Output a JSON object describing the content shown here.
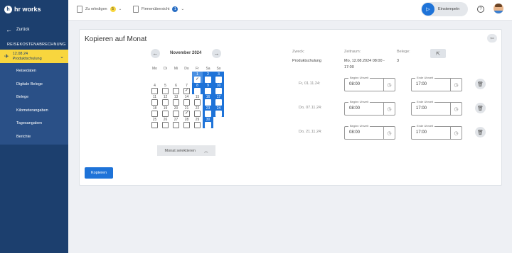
{
  "app": {
    "logo": "hr works"
  },
  "sidebar": {
    "back_label": "Zurück",
    "section_title": "REISEKOSTENABRECHNUNG",
    "trip": {
      "date": "12.08.24",
      "name": "Produktschulung"
    },
    "items": [
      "Reisedaten",
      "Digitale Belege",
      "Belege",
      "Kilometerangaben",
      "Tagesangaben",
      "Berichte"
    ]
  },
  "topbar": {
    "todo_label": "Zu erledigen",
    "todo_count": "5",
    "overview_label": "Firmenübersicht",
    "overview_count": "1",
    "clock_in_label": "Einstempeln",
    "help_icon": "?"
  },
  "card": {
    "title": "Kopieren auf Monat",
    "month": "November 2024",
    "weekdays": [
      "Mo",
      "Di",
      "Mi",
      "Do",
      "Fr",
      "Sa",
      "So"
    ],
    "weeks": [
      [
        {
          "d": "",
          "show": false
        },
        {
          "d": "",
          "show": false
        },
        {
          "d": "",
          "show": false
        },
        {
          "d": "",
          "show": false
        },
        {
          "d": "1",
          "checked": true,
          "state": "seltop"
        },
        {
          "d": "2",
          "state": "sel"
        },
        {
          "d": "3",
          "state": "sel"
        }
      ],
      [
        {
          "d": "4"
        },
        {
          "d": "5"
        },
        {
          "d": "6"
        },
        {
          "d": "7",
          "checked": true
        },
        {
          "d": "8",
          "state": "sel"
        },
        {
          "d": "9",
          "state": "sel"
        },
        {
          "d": "10",
          "state": "sel"
        }
      ],
      [
        {
          "d": "11"
        },
        {
          "d": "12"
        },
        {
          "d": "13"
        },
        {
          "d": "14"
        },
        {
          "d": "15"
        },
        {
          "d": "16",
          "state": "sel"
        },
        {
          "d": "17",
          "state": "sel"
        }
      ],
      [
        {
          "d": "18"
        },
        {
          "d": "19"
        },
        {
          "d": "20"
        },
        {
          "d": "21",
          "checked": true
        },
        {
          "d": "22"
        },
        {
          "d": "23",
          "state": "sel"
        },
        {
          "d": "24",
          "state": "sel"
        }
      ],
      [
        {
          "d": "25"
        },
        {
          "d": "26"
        },
        {
          "d": "27"
        },
        {
          "d": "28"
        },
        {
          "d": "29"
        },
        {
          "d": "30",
          "state": "sel"
        },
        {
          "d": "",
          "show": false
        }
      ]
    ],
    "month_select_label": "Monat selektieren",
    "copy_button": "Kopieren",
    "info": {
      "purpose_label": "Zweck:",
      "purpose": "Produktschulung",
      "period_label": "Zeitraum:",
      "period_line1": "Mo, 12.08.2024 08:00 -",
      "period_line2": "17:00",
      "receipts_label": "Belege:",
      "receipts": "3"
    },
    "rows": [
      {
        "date": "Fr, 01.11.24:",
        "start_label": "Beginn Uhrzeit",
        "start": "08:00",
        "end_label": "Ende Uhrzeit",
        "end": "17:00"
      },
      {
        "date": "Do, 07.11.24:",
        "start_label": "Beginn Uhrzeit",
        "start": "08:00",
        "end_label": "Ende Uhrzeit",
        "end": "17:00"
      },
      {
        "date": "Do, 21.11.24:",
        "start_label": "Beginn Uhrzeit",
        "start": "08:00",
        "end_label": "Ende Uhrzeit",
        "end": "17:00"
      }
    ]
  },
  "colors": {
    "sidebar": "#1c3f6e",
    "accent": "#1e73d8",
    "highlight": "#f8d63e"
  }
}
